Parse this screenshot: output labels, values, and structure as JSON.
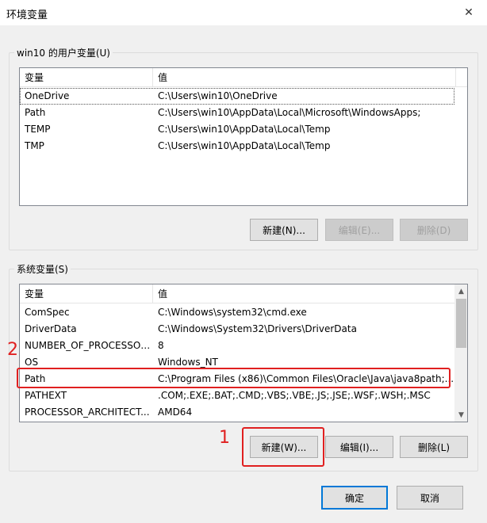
{
  "window": {
    "title": "环境变量",
    "close_icon": "✕"
  },
  "user_vars": {
    "legend": "win10 的用户变量(U)",
    "columns": [
      "变量",
      "值"
    ],
    "rows": [
      {
        "name": "OneDrive",
        "value": "C:\\Users\\win10\\OneDrive"
      },
      {
        "name": "Path",
        "value": "C:\\Users\\win10\\AppData\\Local\\Microsoft\\WindowsApps;"
      },
      {
        "name": "TEMP",
        "value": "C:\\Users\\win10\\AppData\\Local\\Temp"
      },
      {
        "name": "TMP",
        "value": "C:\\Users\\win10\\AppData\\Local\\Temp"
      }
    ],
    "buttons": {
      "new": "新建(N)...",
      "edit": "编辑(E)...",
      "delete": "删除(D)"
    }
  },
  "system_vars": {
    "legend": "系统变量(S)",
    "columns": [
      "变量",
      "值"
    ],
    "rows": [
      {
        "name": "ComSpec",
        "value": "C:\\Windows\\system32\\cmd.exe"
      },
      {
        "name": "DriverData",
        "value": "C:\\Windows\\System32\\Drivers\\DriverData"
      },
      {
        "name": "NUMBER_OF_PROCESSORS",
        "value": "8"
      },
      {
        "name": "OS",
        "value": "Windows_NT"
      },
      {
        "name": "Path",
        "value": "C:\\Program Files (x86)\\Common Files\\Oracle\\Java\\java8path;..."
      },
      {
        "name": "PATHEXT",
        "value": ".COM;.EXE;.BAT;.CMD;.VBS;.VBE;.JS;.JSE;.WSF;.WSH;.MSC"
      },
      {
        "name": "PROCESSOR_ARCHITECT...",
        "value": "AMD64"
      }
    ],
    "buttons": {
      "new": "新建(W)...",
      "edit": "编辑(I)...",
      "delete": "删除(L)"
    }
  },
  "footer": {
    "ok": "确定",
    "cancel": "取消"
  },
  "annotations": {
    "step1": "1",
    "step2": "2",
    "color": "#e02020"
  }
}
